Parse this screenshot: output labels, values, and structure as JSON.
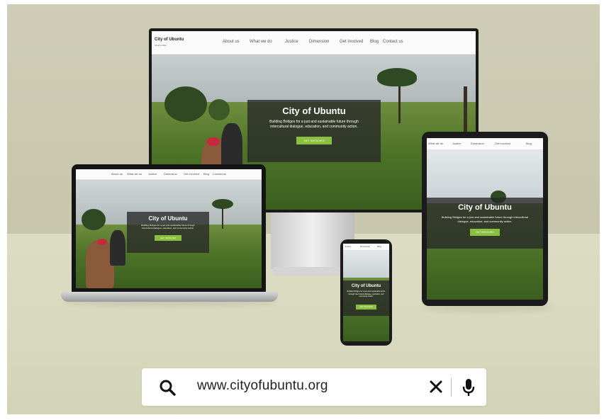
{
  "site": {
    "brand": "City of Ubuntu",
    "brand_sub": "Ubuntu Main",
    "title": "City of Ubuntu",
    "tagline_desktop": "Building Bridges for a just and sustainable future through intercultural dialogue, education, and community action.",
    "tagline_tablet": "Building Bridges for a just and sustainable future through intercultural dialogue, education, and community action.",
    "cta": "GET INVOLVED",
    "nav": [
      "About us",
      "What we do",
      "Justice",
      "Dimension",
      "Get involved",
      "Blog",
      "Contact us"
    ],
    "nav_short": [
      "What we do",
      "Justice",
      "Dimension",
      "Get involved",
      "Blog"
    ]
  },
  "search": {
    "url": "www.cityofubuntu.org",
    "icons": {
      "search": "search-icon",
      "clear": "close-icon",
      "mic": "microphone-icon"
    }
  },
  "colors": {
    "accent": "#8bbf3f",
    "hero_overlay": "#282828",
    "wall": "#cbc9b0",
    "floor": "#d9d9c0"
  }
}
